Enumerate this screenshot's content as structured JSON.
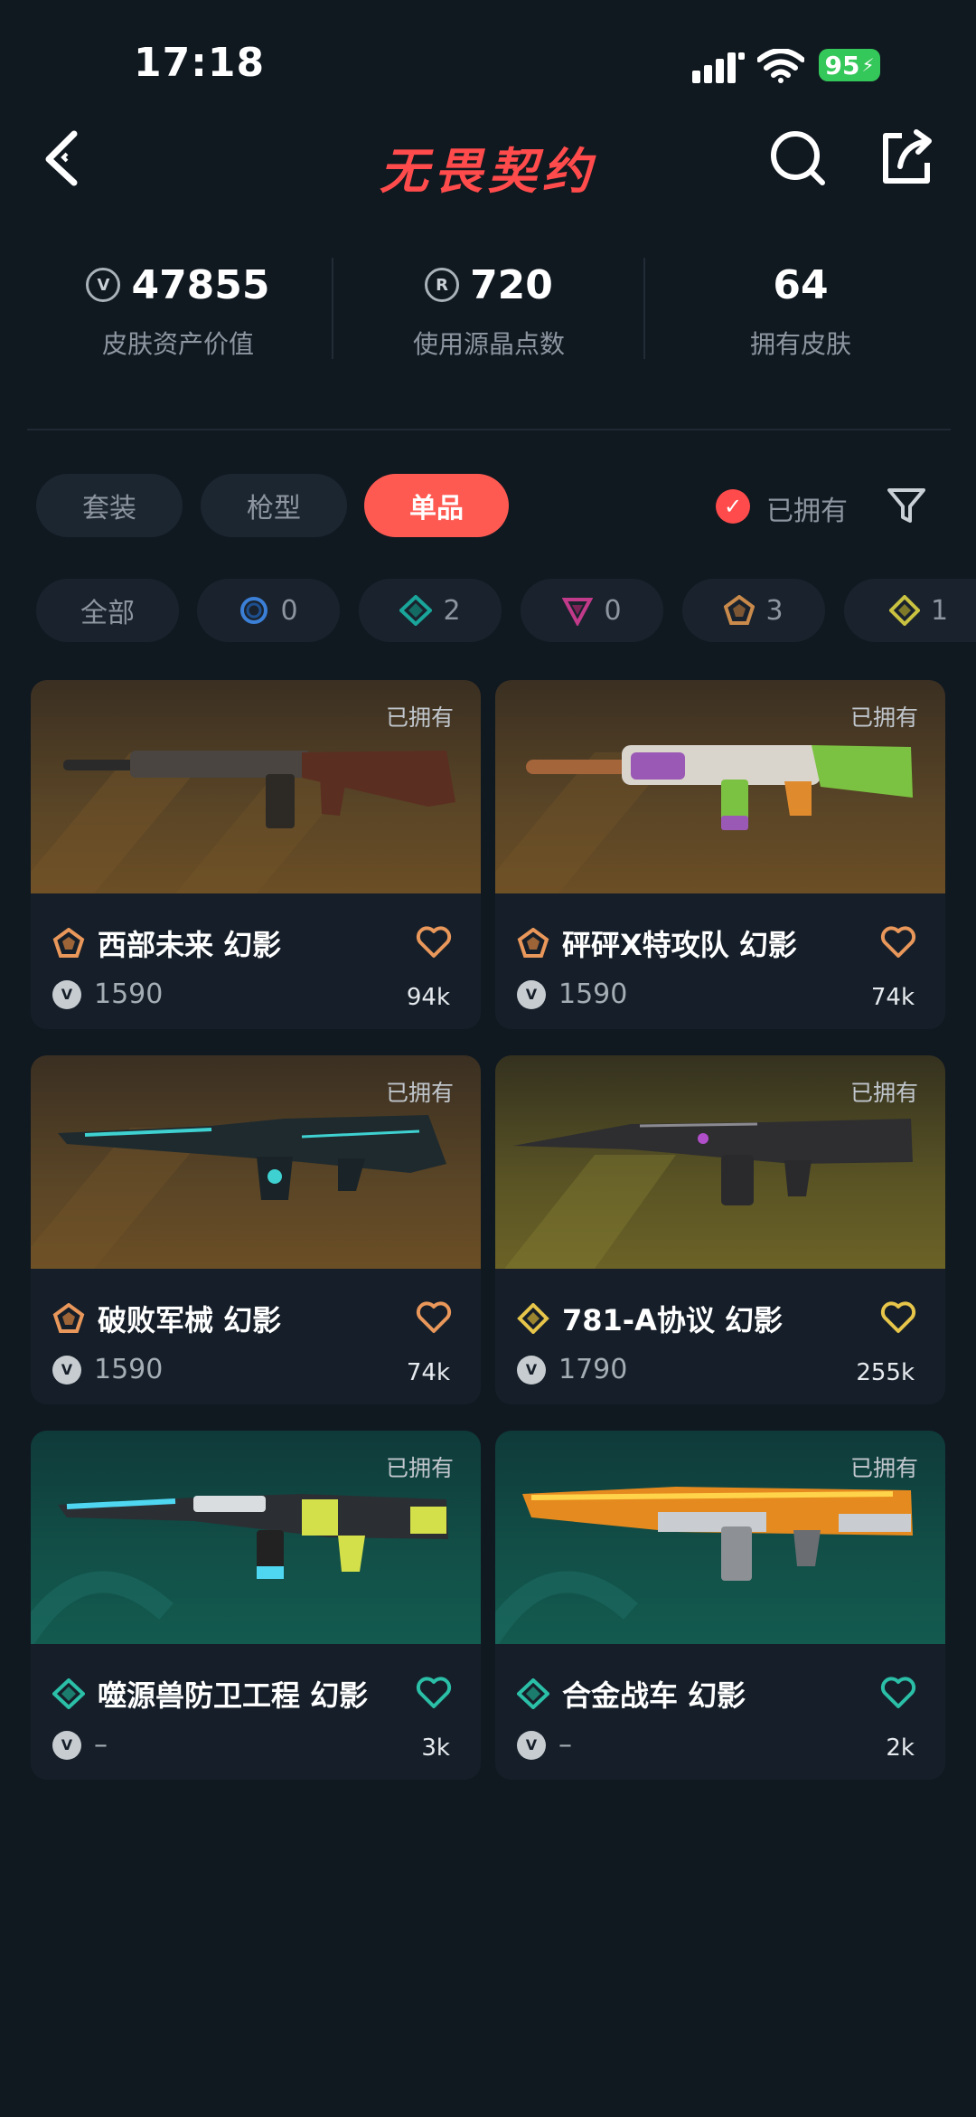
{
  "status_bar": {
    "time": "17:18",
    "battery": "95"
  },
  "header": {
    "title": "无畏契约"
  },
  "stats": [
    {
      "value": "47855",
      "label": "皮肤资产价值",
      "icon": "valorant-points-icon"
    },
    {
      "value": "720",
      "label": "使用源晶点数",
      "icon": "radianite-icon"
    },
    {
      "value": "64",
      "label": "拥有皮肤"
    }
  ],
  "tabs": [
    {
      "label": "套装"
    },
    {
      "label": "枪型"
    },
    {
      "label": "单品",
      "active": true
    }
  ],
  "filter": {
    "owned_label": "已拥有",
    "owned_checked": true
  },
  "rarity_chips": [
    {
      "label": "全部"
    },
    {
      "count": "0",
      "color": "#3b7fd6",
      "shape": "circle"
    },
    {
      "count": "2",
      "color": "#1aa59a",
      "shape": "diamond"
    },
    {
      "count": "0",
      "color": "#c23a8a",
      "shape": "triangle"
    },
    {
      "count": "3",
      "color": "#c98a4b",
      "shape": "pentagon"
    },
    {
      "count": "1",
      "color": "#c9c241",
      "shape": "diamond"
    }
  ],
  "colors": {
    "accent": "#ff5a52",
    "bronze": "#e9975a",
    "gold": "#e6c54a",
    "teal": "#2bbfa8"
  },
  "skins": [
    {
      "name": "西部未来 幻影",
      "price": "1590",
      "likes": "94k",
      "owned": "已拥有",
      "tier": "bronze"
    },
    {
      "name": "砰砰X特攻队 幻影",
      "price": "1590",
      "likes": "74k",
      "owned": "已拥有",
      "tier": "bronze"
    },
    {
      "name": "破败军械 幻影",
      "price": "1590",
      "likes": "74k",
      "owned": "已拥有",
      "tier": "bronze"
    },
    {
      "name": "781-A协议 幻影",
      "price": "1790",
      "likes": "255k",
      "owned": "已拥有",
      "tier": "gold"
    },
    {
      "name": "噬源兽防卫工程 幻影",
      "price": "–",
      "likes": "3k",
      "owned": "已拥有",
      "tier": "teal"
    },
    {
      "name": "合金战车 幻影",
      "price": "–",
      "likes": "2k",
      "owned": "已拥有",
      "tier": "teal"
    }
  ]
}
